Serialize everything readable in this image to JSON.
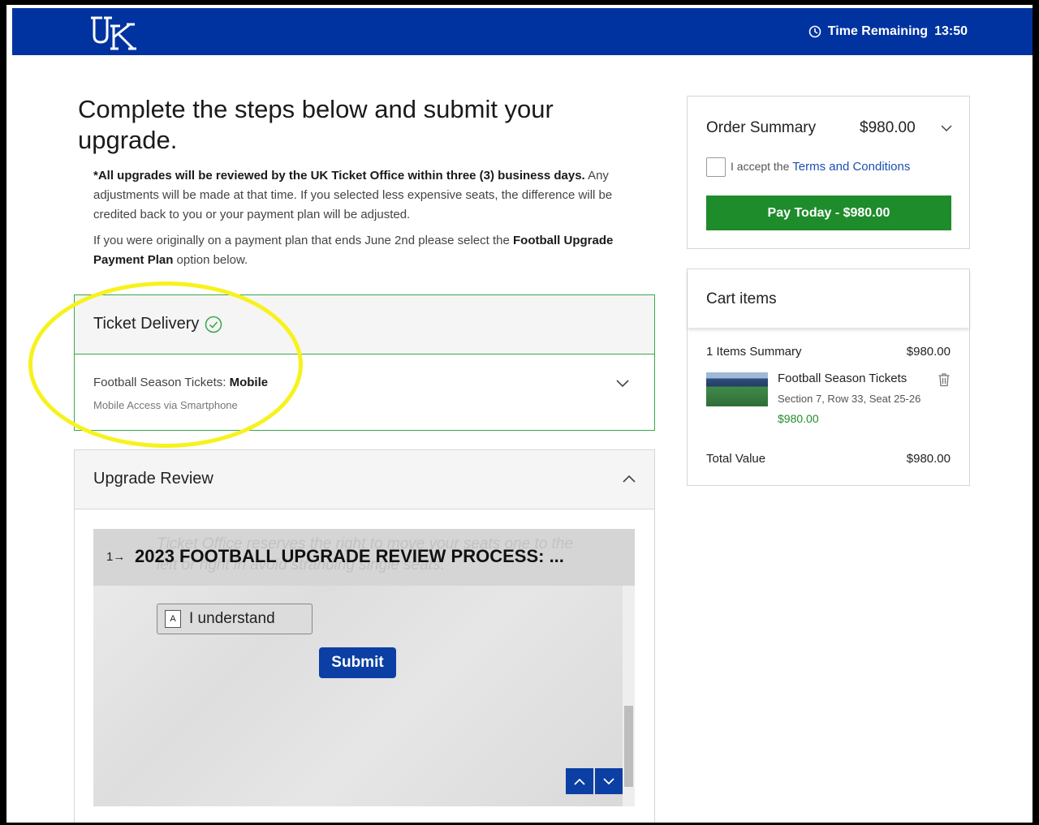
{
  "header": {
    "logo_alt": "UK",
    "timer_label": "Time Remaining",
    "timer_value": "13:50",
    "brand_color": "#0033a0"
  },
  "main": {
    "heading": "Complete the steps below and submit your upgrade.",
    "note1_bold": "*All upgrades will be reviewed by the UK Ticket Office within three (3) business days.",
    "note1_rest": " Any adjustments will be made at that time. If you selected less expensive seats, the difference will be credited back to you or your payment plan will be adjusted.",
    "note2_pre": "If you were originally on a payment plan that ends June 2nd please select the ",
    "note2_bold": "Football Upgrade Payment Plan",
    "note2_post": " option below."
  },
  "delivery": {
    "title": "Ticket Delivery",
    "line_label": "Football Season Tickets: ",
    "line_value": "Mobile",
    "subtext": "Mobile Access via Smartphone",
    "accent": "#39a74a",
    "icons": {
      "status": "check-circle-icon",
      "toggle": "chevron-down-icon"
    }
  },
  "review": {
    "title": "Upgrade Review",
    "ghost_text": "Ticket Office reserves the right to move your seats one to the left or right in avoid stranding single seats.",
    "question_number": "1→",
    "question_title": "2023 FOOTBALL UPGRADE REVIEW PROCESS: ...",
    "choice_key": "A",
    "choice_label": "I understand",
    "submit_label": "Submit",
    "icons": {
      "toggle": "chevron-up-icon",
      "prev": "chevron-up-icon",
      "next": "chevron-down-icon"
    }
  },
  "order_summary": {
    "title": "Order Summary",
    "total": "$980.00",
    "accept_pre": "I accept the ",
    "terms_link": "Terms and Conditions",
    "pay_label": "Pay Today - $980.00",
    "pay_color": "#1e8c2a"
  },
  "cart": {
    "title": "Cart items",
    "summary_label": "1 Items Summary",
    "summary_value": "$980.00",
    "item": {
      "name": "Football Season Tickets",
      "seat": "Section 7, Row 33, Seat 25-26",
      "price": "$980.00"
    },
    "total_label": "Total Value",
    "total_value": "$980.00"
  },
  "annotation": {
    "highlight_color": "#f7f21c"
  }
}
